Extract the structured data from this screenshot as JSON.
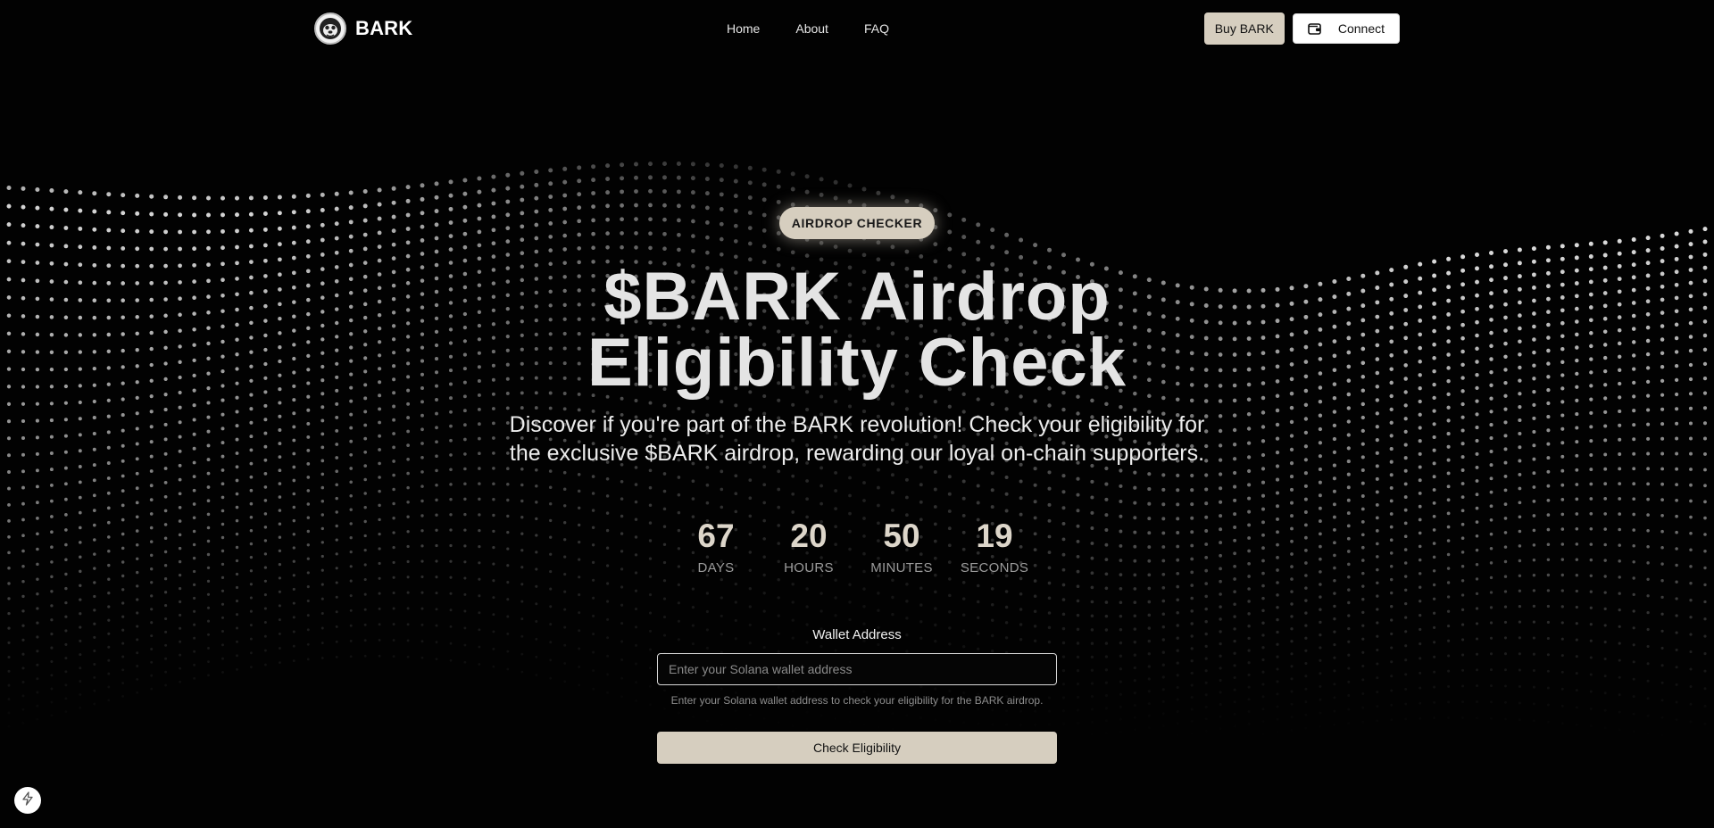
{
  "header": {
    "brand": "BARK",
    "nav": [
      "Home",
      "About",
      "FAQ"
    ],
    "buy_label": "Buy BARK",
    "connect_label": "Connect"
  },
  "hero": {
    "badge": "AIRDROP CHECKER",
    "title_line1": "$BARK Airdrop",
    "title_line2": "Eligibility Check",
    "subtitle": "Discover if you're part of the BARK revolution! Check your eligibility for the exclusive $BARK airdrop, rewarding our loyal on-chain supporters."
  },
  "countdown": [
    {
      "value": "67",
      "label": "DAYS"
    },
    {
      "value": "20",
      "label": "HOURS"
    },
    {
      "value": "50",
      "label": "MINUTES"
    },
    {
      "value": "19",
      "label": "SECONDS"
    }
  ],
  "form": {
    "label": "Wallet Address",
    "placeholder": "Enter your Solana wallet address",
    "value": "",
    "helper": "Enter your Solana wallet address to check your eligibility for the BARK airdrop.",
    "submit_label": "Check Eligibility"
  },
  "icons": {
    "logo": "bark-dog-logo",
    "connect": "wallet-icon",
    "corner": "lightning-bolt-icon"
  },
  "colors": {
    "accent": "#d6cebf",
    "background": "#020202",
    "title": "#e4e4e4"
  }
}
